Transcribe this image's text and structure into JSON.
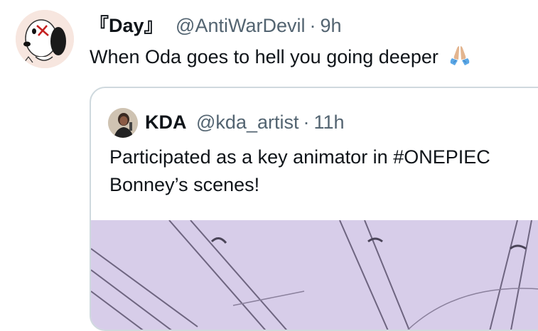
{
  "tweet": {
    "display_name": "『Day』",
    "handle": "@AntiWarDevil",
    "separator": "·",
    "time": "9h",
    "text": "When Oda goes to hell you going deeper",
    "emoji": "folded-hands-icon"
  },
  "quoted_tweet": {
    "display_name": "KDA",
    "handle": "@kda_artist",
    "separator": "·",
    "time": "11h",
    "text_line1": "Participated as a key animator in #ONEPIEC",
    "text_line2": "Bonney’s scenes!",
    "media": "anime-background-image"
  },
  "colors": {
    "text": "#0f1419",
    "secondary": "#536471",
    "border": "#cfd9de",
    "media_bg": "#d6cce8"
  }
}
